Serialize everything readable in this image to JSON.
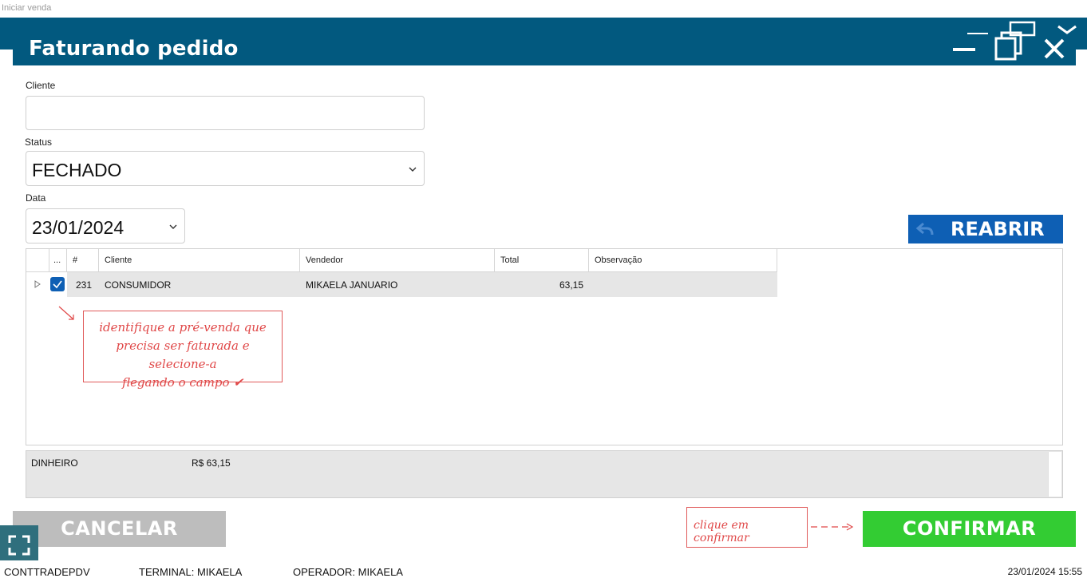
{
  "app": {
    "window_title": "Iniciar venda"
  },
  "dialog": {
    "title": "Faturando pedido"
  },
  "icons": {
    "minimize": "minimize-icon",
    "restore": "restore-icon",
    "close": "close-icon",
    "dropdown": "chevron-down-icon",
    "undo": "undo-arrow-icon",
    "expand": "expand-corners-icon"
  },
  "form": {
    "cliente": {
      "label": "Cliente",
      "value": ""
    },
    "status": {
      "label": "Status",
      "value": "FECHADO"
    },
    "data": {
      "label": "Data",
      "value": "23/01/2024"
    }
  },
  "reopen_button": {
    "label": "REABRIR"
  },
  "grid": {
    "columns": [
      "...",
      "#",
      "Cliente",
      "Vendedor",
      "Total",
      "Observação"
    ],
    "rows": [
      {
        "selected": true,
        "number": "231",
        "cliente": "CONSUMIDOR",
        "vendedor": "MIKAELA JANUARIO",
        "total": "63,15",
        "observacao": ""
      }
    ]
  },
  "annotations": {
    "select_hint": [
      "identifique a pré-venda que",
      "precisa ser faturada e selecione-a",
      "flegando o campo ✔"
    ],
    "confirm_hint": "clique em confirmar"
  },
  "payment": {
    "method": "DINHEIRO",
    "amount": "R$ 63,15"
  },
  "buttons": {
    "cancel": "CANCELAR",
    "confirm": "CONFIRMAR"
  },
  "statusbar": {
    "app": "CONTTRADEPDV",
    "terminal": "TERMINAL: MIKAELA",
    "operator": "OPERADOR: MIKAELA",
    "datetime": "23/01/2024 15:55"
  },
  "colors": {
    "titlebar": "#02597f",
    "reopen": "#0e5fb4",
    "confirm": "#33cc33",
    "cancel": "#bdbdbd",
    "annotation": "#e04848"
  }
}
